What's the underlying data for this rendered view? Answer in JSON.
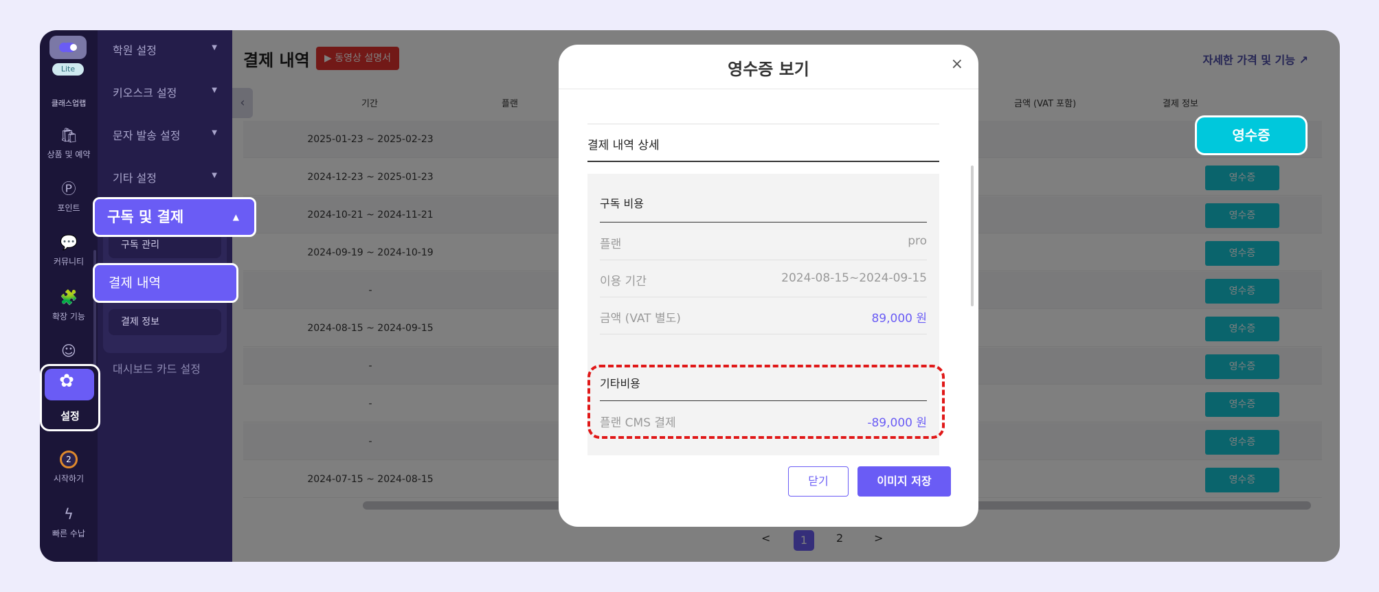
{
  "rail": {
    "badge_lite": "Lite",
    "brand": "클래스업랩",
    "items": [
      {
        "icon": "shopping-bag-icon",
        "glyph": "🛍",
        "label": "상품 및 예약"
      },
      {
        "icon": "point-icon",
        "glyph": "Ⓟ",
        "label": "포인트"
      },
      {
        "icon": "chat-icon",
        "glyph": "💬",
        "label": "커뮤니티"
      },
      {
        "icon": "puzzle-icon",
        "glyph": "🧩",
        "label": "확장 기능"
      }
    ],
    "settings_label": "설정",
    "start_badge": "2",
    "start_label": "시작하기",
    "quick_label": "빠른 수납"
  },
  "nav": {
    "academy_settings": "학원 설정",
    "kiosk_settings": "키오스크 설정",
    "sms_settings": "문자 발송 설정",
    "other_settings": "기타 설정",
    "subscription_payment": "구독 및 결제",
    "subscription_manage": "구독 관리",
    "payment_history": "결제 내역",
    "payment_info": "결제 정보",
    "dashboard_card": "대시보드 카드 설정"
  },
  "main": {
    "title": "결제 내역",
    "video_guide": "동영상 설명서",
    "detail_link": "자세한 가격 및 기능",
    "columns": {
      "period": "기간",
      "plan": "플랜",
      "amount": "금액 (VAT 포함)",
      "pay_info": "결제 정보"
    },
    "receipt_label": "영수증",
    "rows": [
      {
        "period": "2025-01-23 ~ 2025-02-23"
      },
      {
        "period": "2024-12-23 ~ 2025-01-23"
      },
      {
        "period": "2024-10-21 ~ 2024-11-21"
      },
      {
        "period": "2024-09-19 ~ 2024-10-19"
      },
      {
        "period": "-"
      },
      {
        "period": "2024-08-15 ~ 2024-09-15"
      },
      {
        "period": "-"
      },
      {
        "period": "-"
      },
      {
        "period": "-"
      },
      {
        "period": "2024-07-15 ~ 2024-08-15"
      }
    ],
    "pager": {
      "prev": "<",
      "pages": [
        "1",
        "2"
      ],
      "next": ">"
    }
  },
  "modal": {
    "title": "영수증 보기",
    "close_icon": "×",
    "section_title": "결제 내역 상세",
    "subscription": {
      "title": "구독 비용",
      "plan_label": "플랜",
      "plan_value": "pro",
      "period_label": "이용 기간",
      "period_value": "2024-08-15~2024-09-15",
      "amount_label": "금액 (VAT 별도)",
      "amount_value": "89,000 원"
    },
    "other": {
      "title": "기타비용",
      "cms_label": "플랜 CMS 결제",
      "cms_value": "-89,000 원"
    },
    "close_button": "닫기",
    "save_button": "이미지 저장"
  },
  "colors": {
    "accent": "#6a5cf5",
    "receipt": "#14c8d8",
    "highlight_cyan": "#00c8dc",
    "dashed_red": "#e01818"
  }
}
